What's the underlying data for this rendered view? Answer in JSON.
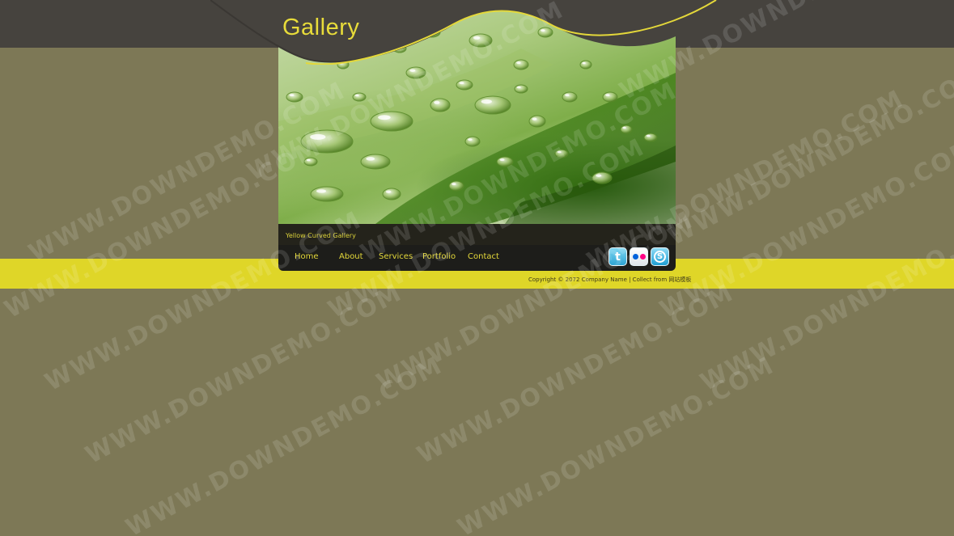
{
  "header": {
    "title": "Gallery"
  },
  "hero": {
    "caption": "Yellow Curved Gallery"
  },
  "nav": {
    "items": [
      "Home",
      "About",
      "Services",
      "Portfolio",
      "Contact"
    ]
  },
  "social": {
    "icons": [
      "twitter-icon",
      "flickr-icon",
      "skype-icon"
    ],
    "twitter_letter": "t",
    "skype_letter": "S"
  },
  "footer": {
    "copyright": "Copyright © 2072 Company Name | Collect from 网站模板"
  },
  "watermark": {
    "text": "WWW.DOWNDEMO.COM"
  },
  "colors": {
    "background": "#7d7856",
    "topbar": "#46433e",
    "accent_yellow": "#dfd628",
    "nav_bg": "#1d1d1a",
    "link": "#e4d83a",
    "flickr_blue": "#0063dc",
    "flickr_pink": "#ff0084"
  }
}
